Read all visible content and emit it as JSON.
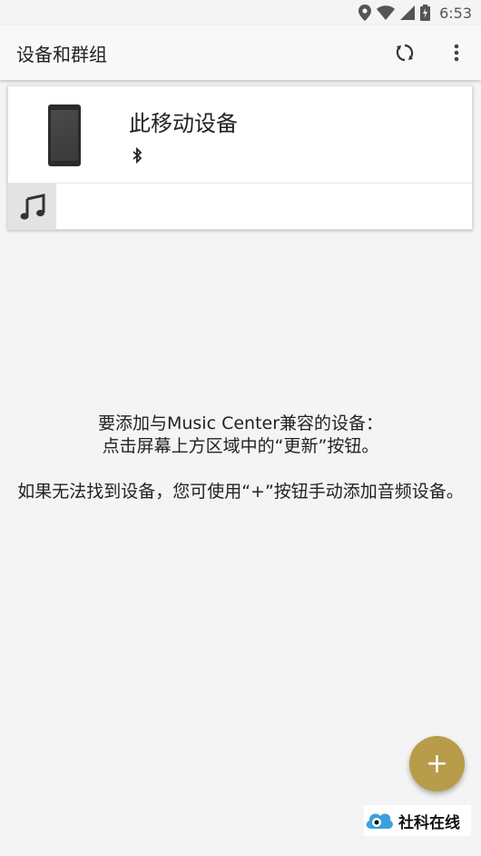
{
  "status_bar": {
    "time": "6:53",
    "icons": [
      "location-icon",
      "wifi-icon",
      "signal-icon",
      "battery-icon"
    ]
  },
  "app_bar": {
    "title": "设备和群组",
    "actions": [
      "refresh-icon",
      "more-vert-icon"
    ]
  },
  "device_card": {
    "name": "此移动设备",
    "connection_icon": "bluetooth-icon",
    "tabs": [
      "music-note-icon"
    ]
  },
  "empty_state": {
    "line1": "要添加与Music Center兼容的设备：",
    "line2": "点击屏幕上方区域中的“更新”按钮。",
    "line3": "如果无法找到设备，您可使用“+”按钮手动添加音频设备。"
  },
  "fab": {
    "label": "+",
    "color": "#b89c4a"
  },
  "watermark": {
    "text": "社科在线"
  }
}
